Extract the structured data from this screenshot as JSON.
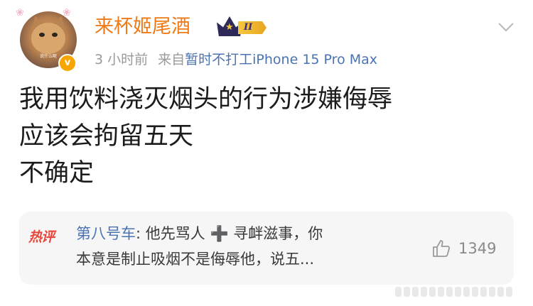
{
  "post": {
    "author": {
      "name": "来杯姬尾酒",
      "avatar_caption": "说什么呢",
      "verified_mark": "v",
      "rank_numeral": "II"
    },
    "meta": {
      "time": "3 小时前",
      "source_prefix": "来自",
      "source_device": "暂时不打工iPhone 15 Pro Max"
    },
    "content_lines": [
      "我用饮料浇灭烟头的行为涉嫌侮辱",
      "应该会拘留五天",
      "不确定"
    ]
  },
  "hot_comment": {
    "label": "热评",
    "author": "第八号车",
    "separator": ": ",
    "line1": "他先骂人 ➕ 寻衅滋事，你",
    "line2": "本意是制止吸烟不是侮辱他，说五...",
    "like_count": "1349"
  },
  "icons": {
    "more": "chevron-down-icon",
    "like": "thumbs-up-icon",
    "verified": "verified-badge-icon",
    "rank": "crown-rank-badge-icon"
  },
  "colors": {
    "username": "#ee7a18",
    "link": "#4a73b2",
    "hot_label": "#e8473c",
    "meta_gray": "#9a9a9a",
    "verified": "#f7a500",
    "comment_bg": "#f6f6f6"
  }
}
